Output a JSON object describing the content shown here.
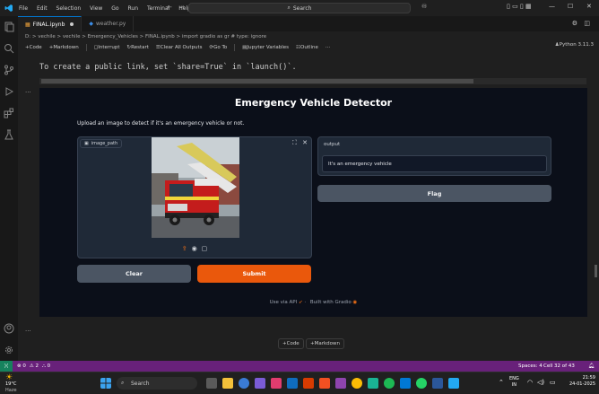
{
  "menu": [
    "File",
    "Edit",
    "Selection",
    "View",
    "Go",
    "Run",
    "Terminal",
    "Help"
  ],
  "search": {
    "label": "Search"
  },
  "tabs": [
    {
      "label": "FINAL.ipynb",
      "active": true
    },
    {
      "label": "weather.py",
      "active": false
    }
  ],
  "breadcrumb": "D: > vechile > vechile > Emergency_Vehicles > FINAL.ipynb > import gradio as gr # type: ignore",
  "toolbar": {
    "code": "Code",
    "markdown": "Markdown",
    "interrupt": "Interrupt",
    "restart": "Restart",
    "clear_all": "Clear All Outputs",
    "goto": "Go To",
    "jupyter_vars": "Jupyter Variables",
    "outline": "Outline",
    "more": "···",
    "kernel": "Python 3.11.3"
  },
  "cell_output": "To create a public link, set `share=True` in `launch()`.",
  "cell_more": "···",
  "gradio": {
    "title": "Emergency Vehicle Detector",
    "description": "Upload an image to detect if it's an emergency vehicle or not.",
    "image_label": "image_path",
    "output_label": "output",
    "output_value": "It's an emergency vehicle",
    "flag_label": "Flag",
    "clear_label": "Clear",
    "submit_label": "Submit",
    "footer_api": "Use via API",
    "footer_sep": "·",
    "footer_built": "Built with Gradio"
  },
  "add_cell": {
    "code": "Code",
    "markdown": "Markdown"
  },
  "status": {
    "errors": "0",
    "warnings": "2",
    "ports": "0",
    "spaces": "Spaces: 4",
    "cell": "Cell 32 of 43"
  },
  "taskbar": {
    "weather_temp": "19°C",
    "weather_desc": "Haze",
    "search": "Search",
    "lang_line1": "ENG",
    "lang_line2": "IN",
    "time": "21:59",
    "date": "24-01-2025"
  },
  "colors": {
    "accent_orange": "#ea580c",
    "status_bar": "#68217a",
    "gradio_bg": "#0b0f19"
  }
}
